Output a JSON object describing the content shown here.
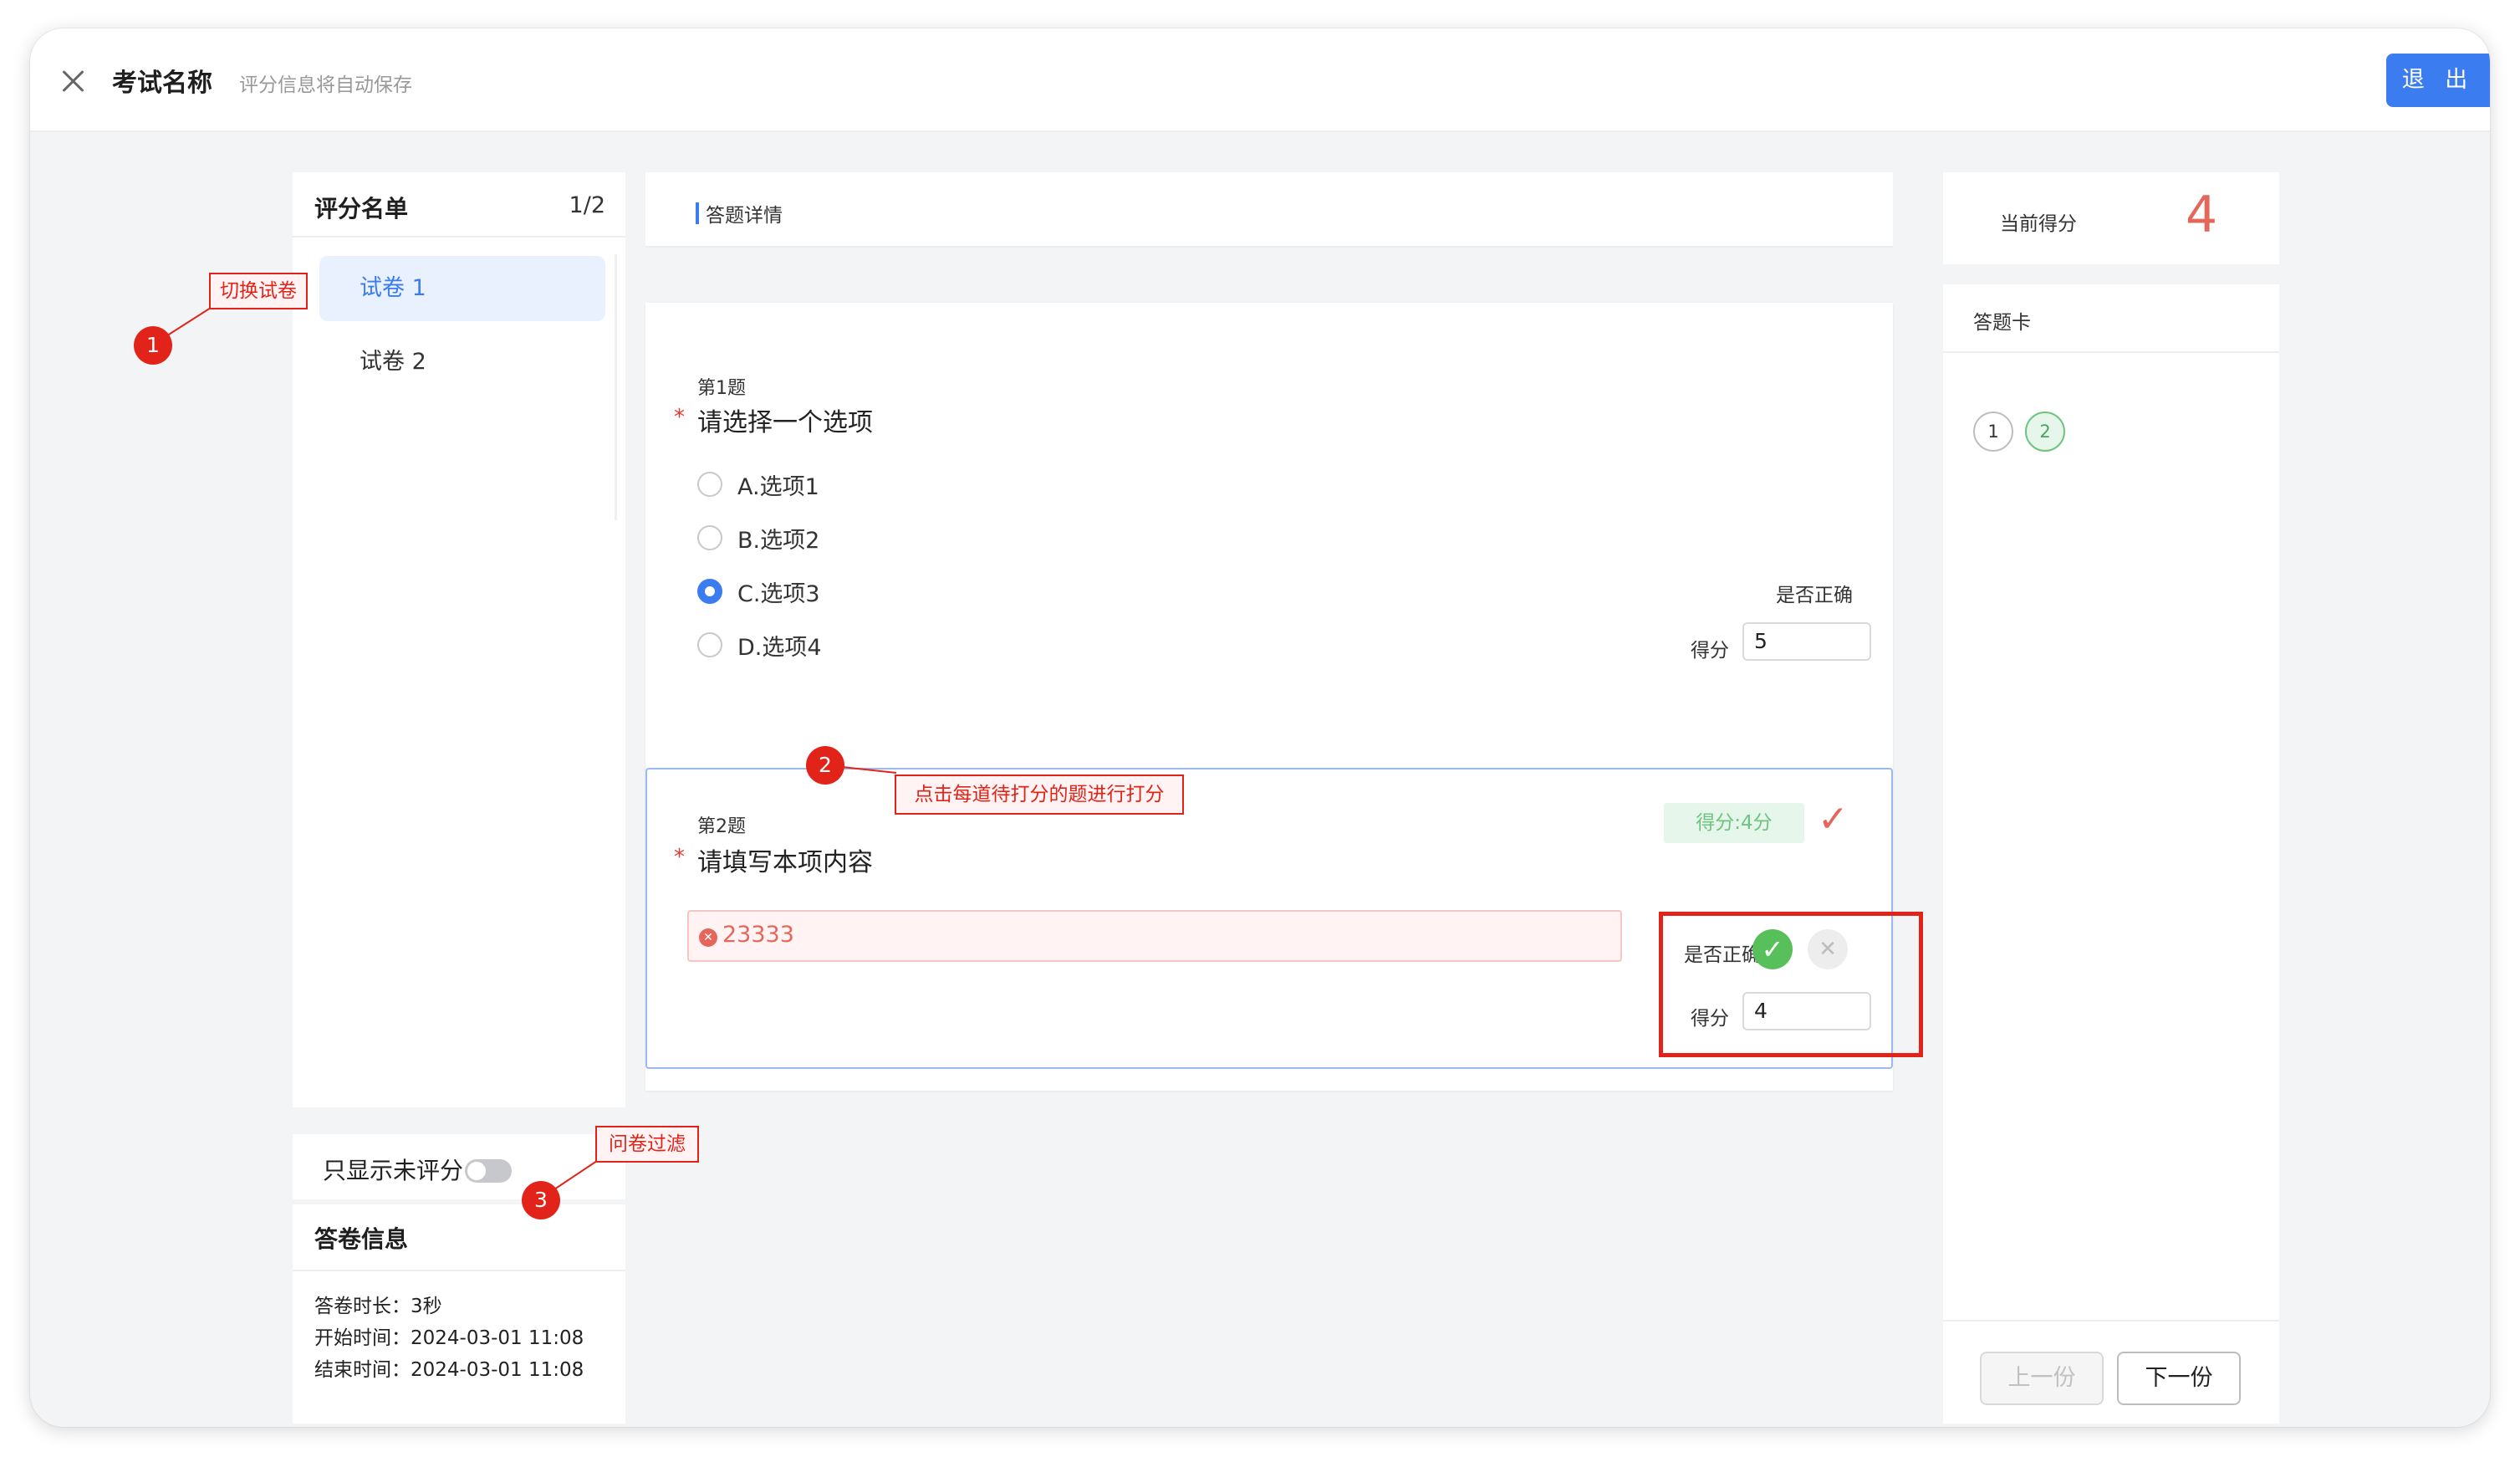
{
  "header": {
    "title": "考试名称",
    "subtitle": "评分信息将自动保存",
    "exit_label": "退 出"
  },
  "left": {
    "title": "评分名单",
    "count": "1/2",
    "papers": [
      {
        "label": "试卷 1",
        "active": true
      },
      {
        "label": "试卷 2",
        "active": false
      }
    ],
    "filter_label": "只显示未评分",
    "filter_on": false
  },
  "answer_info": {
    "title": "答卷信息",
    "duration": "答卷时长：3秒",
    "start": "开始时间：2024-03-01 11:08",
    "end": "结束时间：2024-03-01 11:08"
  },
  "detail": {
    "title": "答题详情",
    "questions": [
      {
        "num": "第1题",
        "star": "*",
        "title": "请选择一个选项",
        "options": [
          {
            "label": "A.选项1",
            "checked": false
          },
          {
            "label": "B.选项2",
            "checked": false
          },
          {
            "label": "C.选项3",
            "checked": true
          },
          {
            "label": "D.选项4",
            "checked": false
          }
        ],
        "correct_label": "是否正确",
        "score_label": "得分",
        "score": "5"
      },
      {
        "num": "第2题",
        "star": "*",
        "title": "请填写本项内容",
        "answer": "23333",
        "score_badge": "得分:4分",
        "correct_label": "是否正确",
        "score_label": "得分",
        "score": "4"
      }
    ]
  },
  "score_panel": {
    "label": "当前得分",
    "value": "4"
  },
  "card": {
    "title": "答题卡",
    "numbers": [
      "1",
      "2"
    ],
    "prev_label": "上一份",
    "next_label": "下一份"
  },
  "annotations": [
    {
      "num": "1",
      "text": "切换试卷"
    },
    {
      "num": "2",
      "text": "点击每道待打分的题进行打分"
    },
    {
      "num": "3",
      "text": "问卷过滤"
    }
  ],
  "colors": {
    "primary": "#3b7cf0",
    "annotation": "#e2231a",
    "success": "#58c05a",
    "score": "#e5675c"
  }
}
